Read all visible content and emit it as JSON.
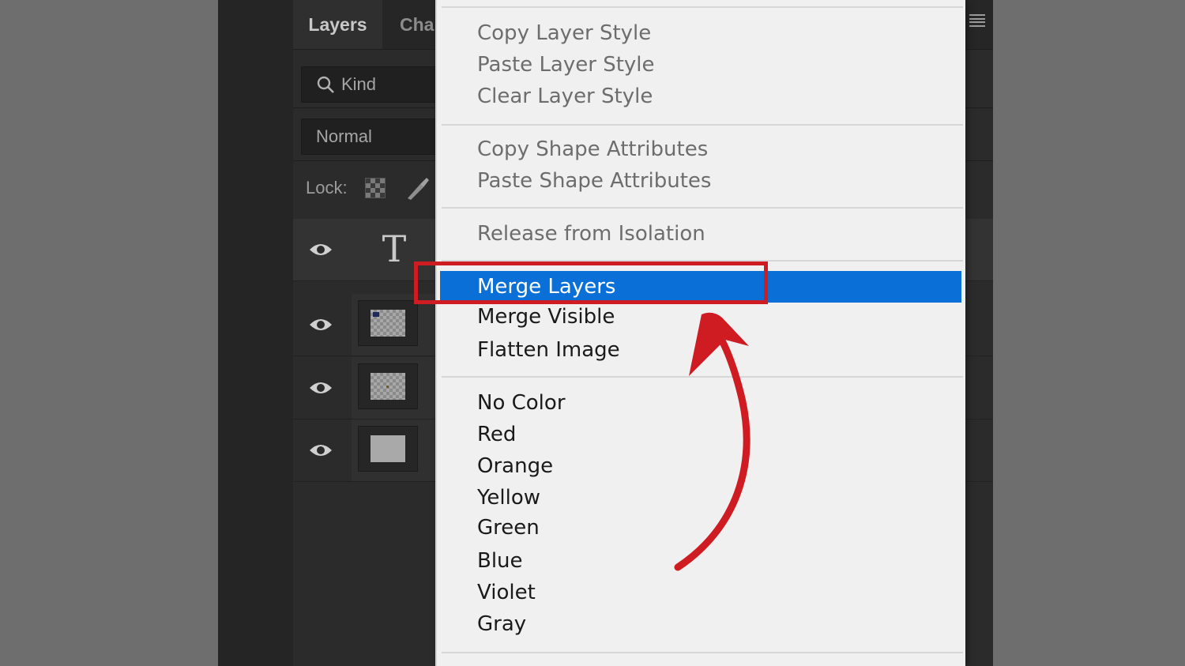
{
  "colors": {
    "highlight": "#0a6fd6",
    "annotation": "#cf1b22",
    "menu_bg": "#f0f0f0",
    "panel_bg": "#2b2b2b"
  },
  "panel": {
    "tabs": [
      {
        "label": "Layers",
        "active": true
      },
      {
        "label": "Cha",
        "active": false
      }
    ],
    "kind_filter": {
      "label": "Kind",
      "icon": "search-icon"
    },
    "blend_mode": {
      "value": "Normal"
    },
    "lock": {
      "label": "Lock:"
    },
    "layers": [
      {
        "icon": "eye-icon",
        "thumbnail": "type-glyph",
        "glyph": "T"
      },
      {
        "icon": "eye-icon",
        "thumbnail": "transparent-thumbnail"
      },
      {
        "icon": "eye-icon",
        "thumbnail": "transparent-thumbnail"
      },
      {
        "icon": "eye-icon",
        "thumbnail": "solid-thumbnail"
      }
    ]
  },
  "context_menu": {
    "groups": [
      {
        "items": [
          {
            "label": "Copy Layer Style",
            "enabled": false
          },
          {
            "label": "Paste Layer Style",
            "enabled": false
          },
          {
            "label": "Clear Layer Style",
            "enabled": false
          }
        ]
      },
      {
        "items": [
          {
            "label": "Copy Shape Attributes",
            "enabled": false
          },
          {
            "label": "Paste Shape Attributes",
            "enabled": false
          }
        ]
      },
      {
        "items": [
          {
            "label": "Release from Isolation",
            "enabled": false
          }
        ]
      },
      {
        "items": [
          {
            "label": "Merge Layers",
            "enabled": true,
            "highlighted": true
          },
          {
            "label": "Merge Visible",
            "enabled": true
          },
          {
            "label": "Flatten Image",
            "enabled": true
          }
        ]
      },
      {
        "items": [
          {
            "label": "No Color",
            "enabled": true
          },
          {
            "label": "Red",
            "enabled": true
          },
          {
            "label": "Orange",
            "enabled": true
          },
          {
            "label": "Yellow",
            "enabled": true
          },
          {
            "label": "Green",
            "enabled": true
          },
          {
            "label": "Blue",
            "enabled": true
          },
          {
            "label": "Violet",
            "enabled": true
          },
          {
            "label": "Gray",
            "enabled": true
          }
        ]
      }
    ]
  }
}
